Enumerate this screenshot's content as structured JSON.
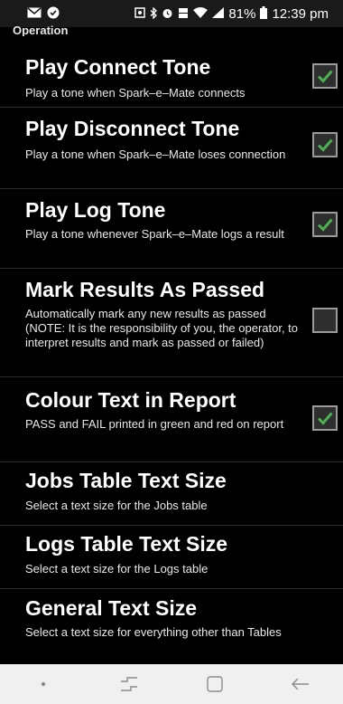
{
  "status_bar": {
    "left_icons": [
      "email-icon",
      "do-not-disturb-icon"
    ],
    "right_icons": [
      "screenshot-icon",
      "bluetooth-icon",
      "alarm-icon",
      "volte-icon",
      "wifi-icon",
      "signal-icon"
    ],
    "battery": "81%",
    "clock": "12:39 pm"
  },
  "section": {
    "header": "Operation"
  },
  "preferences": [
    {
      "title": "Play Connect Tone",
      "summary": "Play a tone when Spark–e–Mate connects",
      "checked": true
    },
    {
      "title": "Play Disconnect Tone",
      "summary": "Play a tone when Spark–e–Mate loses connection",
      "checked": true
    },
    {
      "title": "Play Log Tone",
      "summary": "Play a tone whenever Spark–e–Mate logs a result",
      "checked": true
    },
    {
      "title": "Mark Results As Passed",
      "summary": "Automatically mark any new results as passed (NOTE: It is the responsibility of you, the operator, to interpret results and mark as passed or failed)",
      "checked": false
    },
    {
      "title": "Colour Text in Report",
      "summary": "PASS and FAIL printed in green and red on report",
      "checked": true
    },
    {
      "title": "Jobs Table Text Size",
      "summary": "Select a text size for the Jobs table"
    },
    {
      "title": "Logs Table Text Size",
      "summary": "Select a text size for the Logs table"
    },
    {
      "title": "General Text Size",
      "summary": "Select a text size for everything other than Tables"
    }
  ],
  "colors": {
    "check_green": "#4caf50",
    "background": "#000000",
    "nav_bar": "#f0f0f0"
  },
  "nav_bar": {
    "buttons": [
      "nav-dot-icon",
      "recent-apps-icon",
      "home-icon",
      "back-icon"
    ]
  }
}
